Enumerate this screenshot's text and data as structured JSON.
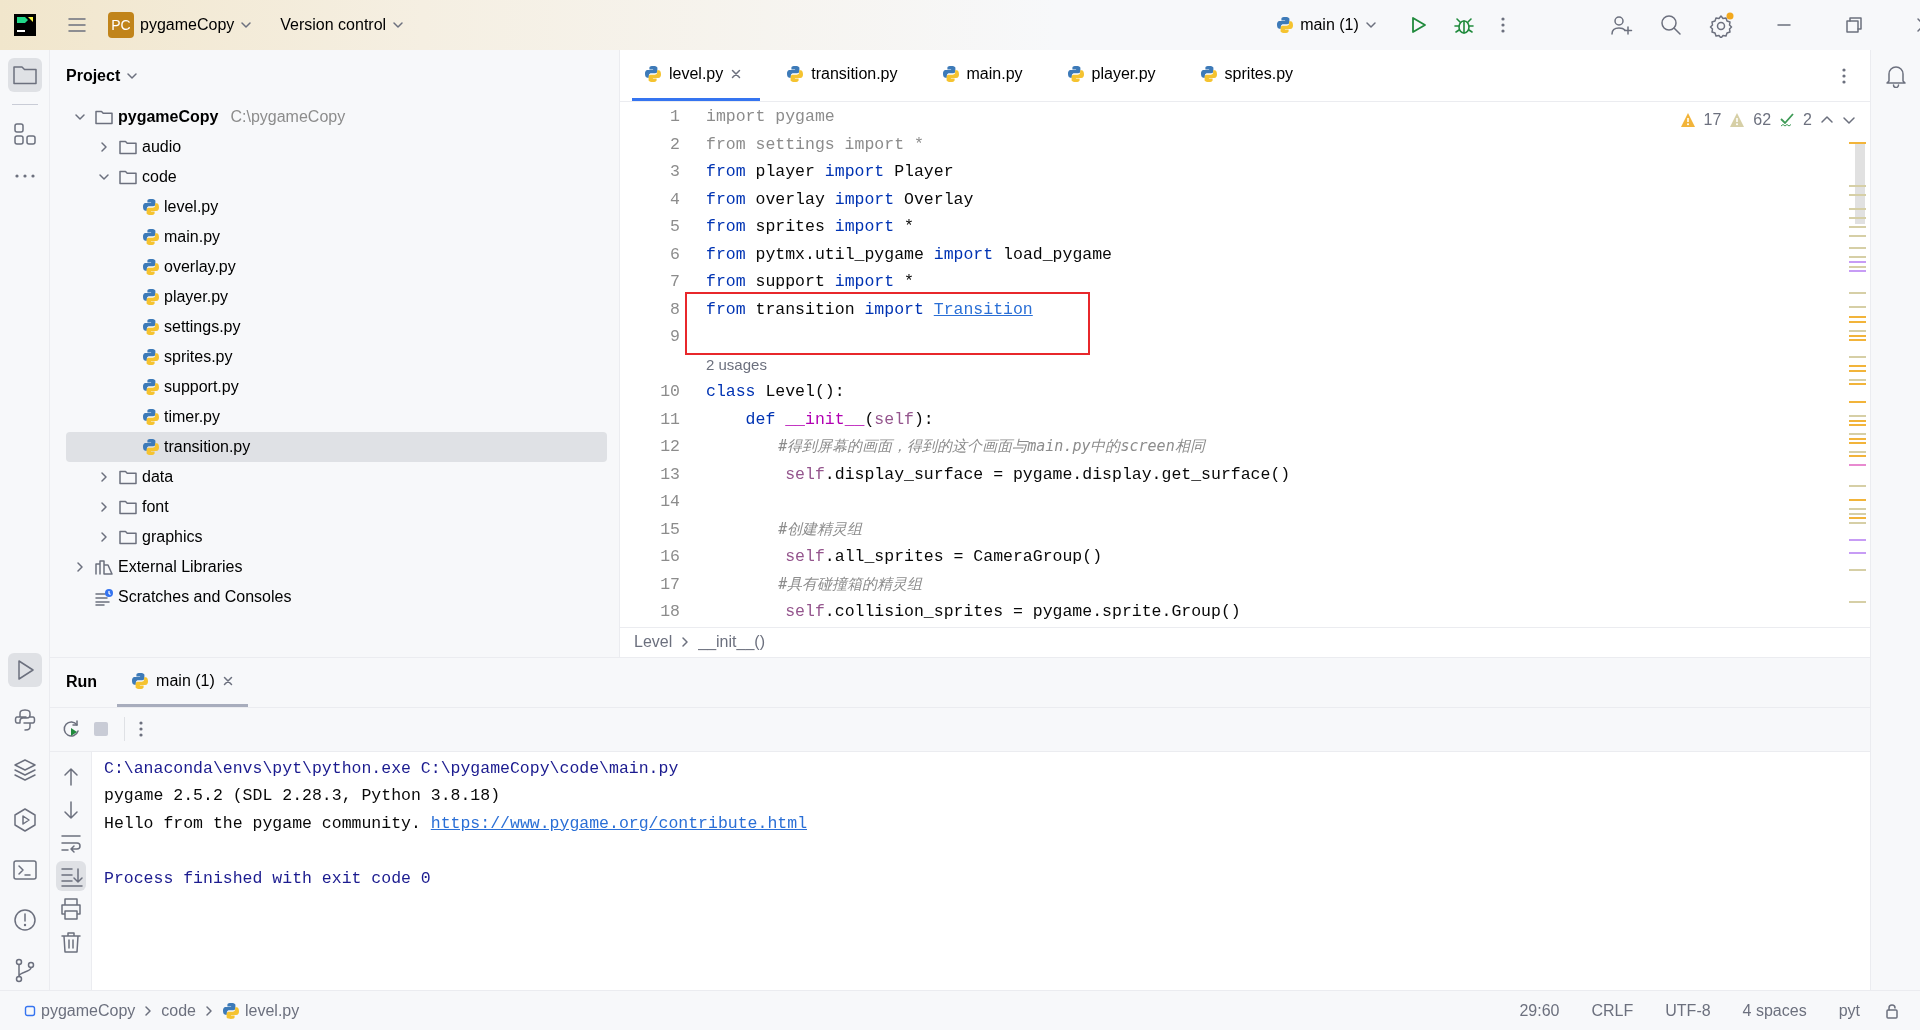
{
  "title_bar": {
    "project_badge": "PC",
    "project": "pygameCopy",
    "vcs": "Version control",
    "run_config": "main (1)"
  },
  "left_toolbar": {
    "top": [
      {
        "kind": "project",
        "selected": true
      },
      {
        "kind": "structure",
        "selected": false
      },
      {
        "kind": "more",
        "selected": false
      }
    ],
    "bottom": [
      {
        "kind": "run",
        "selected": true
      },
      {
        "kind": "python-console",
        "selected": false
      },
      {
        "kind": "layers",
        "selected": false
      },
      {
        "kind": "services",
        "selected": false
      },
      {
        "kind": "terminal",
        "selected": false
      },
      {
        "kind": "problems",
        "selected": false
      },
      {
        "kind": "git",
        "selected": false
      }
    ]
  },
  "project_panel": {
    "title": "Project",
    "tree": [
      {
        "kind": "folder",
        "name": "pygameCopy",
        "path": "C:\\pygameCopy",
        "expanded": true,
        "selected": false,
        "children": [
          {
            "kind": "folder",
            "name": "audio",
            "expanded": false,
            "selected": false
          },
          {
            "kind": "folder",
            "name": "code",
            "expanded": true,
            "selected": false,
            "children": [
              {
                "kind": "python",
                "name": "level.py",
                "selected": false
              },
              {
                "kind": "python",
                "name": "main.py",
                "selected": false
              },
              {
                "kind": "python",
                "name": "overlay.py",
                "selected": false
              },
              {
                "kind": "python",
                "name": "player.py",
                "selected": false
              },
              {
                "kind": "python",
                "name": "settings.py",
                "selected": false
              },
              {
                "kind": "python",
                "name": "sprites.py",
                "selected": false
              },
              {
                "kind": "python",
                "name": "support.py",
                "selected": false
              },
              {
                "kind": "python",
                "name": "timer.py",
                "selected": false
              },
              {
                "kind": "python",
                "name": "transition.py",
                "selected": true
              }
            ]
          },
          {
            "kind": "folder",
            "name": "data",
            "expanded": false,
            "selected": false
          },
          {
            "kind": "folder",
            "name": "font",
            "expanded": false,
            "selected": false
          },
          {
            "kind": "folder",
            "name": "graphics",
            "expanded": false,
            "selected": false
          }
        ]
      },
      {
        "kind": "library",
        "name": "External Libraries",
        "expanded": false,
        "selected": false
      },
      {
        "kind": "scratches",
        "name": "Scratches and Consoles",
        "selected": false
      }
    ]
  },
  "editor": {
    "tabs": [
      {
        "label": "level.py",
        "selected": true
      },
      {
        "label": "transition.py",
        "selected": false
      },
      {
        "label": "main.py",
        "selected": false
      },
      {
        "label": "player.py",
        "selected": false
      },
      {
        "label": "sprites.py",
        "selected": false
      }
    ],
    "inspections": {
      "warnings": "17",
      "weak_warnings": "62",
      "typos": "2"
    },
    "lines": [
      {
        "kind": "code",
        "number": "1",
        "boxed": false,
        "tokens": [
          {
            "kind": "unused",
            "text": "import pygame"
          }
        ]
      },
      {
        "kind": "code",
        "number": "2",
        "boxed": false,
        "tokens": [
          {
            "kind": "unused",
            "text": "from settings import *"
          }
        ]
      },
      {
        "kind": "code",
        "number": "3",
        "boxed": false,
        "tokens": [
          {
            "kind": "keyword",
            "text": "from"
          },
          {
            "kind": "plain",
            "text": " player "
          },
          {
            "kind": "keyword",
            "text": "import"
          },
          {
            "kind": "plain",
            "text": " Player"
          }
        ]
      },
      {
        "kind": "code",
        "number": "4",
        "boxed": false,
        "tokens": [
          {
            "kind": "keyword",
            "text": "from"
          },
          {
            "kind": "plain",
            "text": " overlay "
          },
          {
            "kind": "keyword",
            "text": "import"
          },
          {
            "kind": "plain",
            "text": " Overlay"
          }
        ]
      },
      {
        "kind": "code",
        "number": "5",
        "boxed": false,
        "tokens": [
          {
            "kind": "keyword",
            "text": "from"
          },
          {
            "kind": "plain",
            "text": " sprites "
          },
          {
            "kind": "keyword",
            "text": "import"
          },
          {
            "kind": "plain",
            "text": " *"
          }
        ]
      },
      {
        "kind": "code",
        "number": "6",
        "boxed": false,
        "tokens": [
          {
            "kind": "keyword",
            "text": "from"
          },
          {
            "kind": "plain",
            "text": " pytmx.util_pygame "
          },
          {
            "kind": "keyword",
            "text": "import"
          },
          {
            "kind": "plain",
            "text": " load_pygame"
          }
        ]
      },
      {
        "kind": "code",
        "number": "7",
        "boxed": false,
        "tokens": [
          {
            "kind": "keyword",
            "text": "from"
          },
          {
            "kind": "plain",
            "text": " support "
          },
          {
            "kind": "keyword",
            "text": "import"
          },
          {
            "kind": "plain",
            "text": " *"
          }
        ]
      },
      {
        "kind": "code",
        "number": "8",
        "boxed": true,
        "tokens": [
          {
            "kind": "keyword",
            "text": "from"
          },
          {
            "kind": "plain",
            "text": " transition "
          },
          {
            "kind": "keyword",
            "text": "import "
          },
          {
            "kind": "reference",
            "text": "Transition"
          }
        ]
      },
      {
        "kind": "code",
        "number": "9",
        "boxed": true
      },
      {
        "kind": "inlay",
        "text": "2 usages"
      },
      {
        "kind": "code",
        "number": "10",
        "boxed": false,
        "tokens": [
          {
            "kind": "keyword",
            "text": "class"
          },
          {
            "kind": "plain",
            "text": " Level():"
          }
        ]
      },
      {
        "kind": "code",
        "number": "11",
        "boxed": false,
        "tokens": [
          {
            "kind": "keyword",
            "text": "    def "
          },
          {
            "kind": "dunder",
            "text": "__init__"
          },
          {
            "kind": "plain",
            "text": "("
          },
          {
            "kind": "self",
            "text": "self"
          },
          {
            "kind": "plain",
            "text": "):"
          }
        ]
      },
      {
        "kind": "code",
        "number": "12",
        "boxed": false,
        "tokens": [
          {
            "kind": "comment",
            "text": "        #得到屏幕的画面，得到的这个画面与main.py中的screen相同"
          }
        ]
      },
      {
        "kind": "code",
        "number": "13",
        "boxed": false,
        "tokens": [
          {
            "kind": "self",
            "text": "        self"
          },
          {
            "kind": "plain",
            "text": ".display_surface = pygame.display.get_surface()"
          }
        ]
      },
      {
        "kind": "code",
        "number": "14",
        "boxed": false
      },
      {
        "kind": "code",
        "number": "15",
        "boxed": false,
        "tokens": [
          {
            "kind": "comment",
            "text": "        #创建精灵组"
          }
        ]
      },
      {
        "kind": "code",
        "number": "16",
        "boxed": false,
        "tokens": [
          {
            "kind": "self",
            "text": "        self"
          },
          {
            "kind": "plain",
            "text": ".all_sprites = CameraGroup()"
          }
        ]
      },
      {
        "kind": "code",
        "number": "17",
        "boxed": false,
        "tokens": [
          {
            "kind": "comment",
            "text": "        #具有碰撞箱的精灵组"
          }
        ]
      },
      {
        "kind": "code",
        "number": "18",
        "boxed": false,
        "tokens": [
          {
            "kind": "self",
            "text": "        self"
          },
          {
            "kind": "plain",
            "text": ".collision_sprites = pygame.sprite.Group()"
          }
        ]
      }
    ],
    "breadcrumb": [
      "Level",
      "__init__()"
    ]
  },
  "run_panel": {
    "title": "Run",
    "tabs": [
      {
        "label": "main (1)",
        "selected": true
      }
    ],
    "side_tools": [
      {
        "kind": "up",
        "selected": false
      },
      {
        "kind": "down",
        "selected": false
      },
      {
        "kind": "wrap",
        "selected": false
      },
      {
        "kind": "scroll-end",
        "selected": true
      },
      {
        "kind": "print",
        "selected": false
      },
      {
        "kind": "trash",
        "selected": false
      }
    ],
    "console": [
      {
        "kind": "text",
        "tokens": [
          {
            "kind": "system",
            "text": "C:\\anaconda\\envs\\pyt\\python.exe C:\\pygameCopy\\code\\main.py"
          }
        ]
      },
      {
        "kind": "text",
        "tokens": [
          {
            "kind": "output",
            "text": "pygame 2.5.2 (SDL 2.28.3, Python 3.8.18)"
          }
        ]
      },
      {
        "kind": "text",
        "tokens": [
          {
            "kind": "output",
            "text": "Hello from the pygame community. "
          },
          {
            "kind": "link",
            "text": "https://www.pygame.org/contribute.html"
          }
        ]
      },
      {
        "kind": "blank"
      },
      {
        "kind": "text",
        "tokens": [
          {
            "kind": "system",
            "text": "Process finished with exit code 0"
          }
        ]
      }
    ]
  },
  "status_bar": {
    "path": [
      {
        "kind": "module",
        "text": "pygameCopy"
      },
      {
        "kind": "folder",
        "text": "code"
      },
      {
        "kind": "python",
        "text": "level.py"
      }
    ],
    "items": [
      "29:60",
      "CRLF",
      "UTF-8",
      "4 spaces",
      "pyt"
    ]
  }
}
